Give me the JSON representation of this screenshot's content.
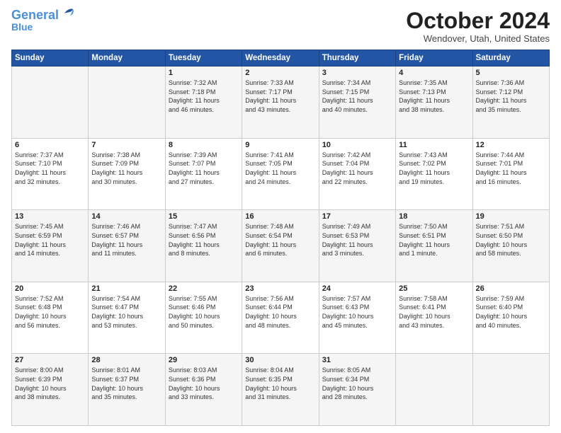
{
  "header": {
    "logo_general": "General",
    "logo_blue": "Blue",
    "month": "October 2024",
    "location": "Wendover, Utah, United States"
  },
  "days_of_week": [
    "Sunday",
    "Monday",
    "Tuesday",
    "Wednesday",
    "Thursday",
    "Friday",
    "Saturday"
  ],
  "weeks": [
    [
      {
        "day": "",
        "info": ""
      },
      {
        "day": "",
        "info": ""
      },
      {
        "day": "1",
        "info": "Sunrise: 7:32 AM\nSunset: 7:18 PM\nDaylight: 11 hours\nand 46 minutes."
      },
      {
        "day": "2",
        "info": "Sunrise: 7:33 AM\nSunset: 7:17 PM\nDaylight: 11 hours\nand 43 minutes."
      },
      {
        "day": "3",
        "info": "Sunrise: 7:34 AM\nSunset: 7:15 PM\nDaylight: 11 hours\nand 40 minutes."
      },
      {
        "day": "4",
        "info": "Sunrise: 7:35 AM\nSunset: 7:13 PM\nDaylight: 11 hours\nand 38 minutes."
      },
      {
        "day": "5",
        "info": "Sunrise: 7:36 AM\nSunset: 7:12 PM\nDaylight: 11 hours\nand 35 minutes."
      }
    ],
    [
      {
        "day": "6",
        "info": "Sunrise: 7:37 AM\nSunset: 7:10 PM\nDaylight: 11 hours\nand 32 minutes."
      },
      {
        "day": "7",
        "info": "Sunrise: 7:38 AM\nSunset: 7:09 PM\nDaylight: 11 hours\nand 30 minutes."
      },
      {
        "day": "8",
        "info": "Sunrise: 7:39 AM\nSunset: 7:07 PM\nDaylight: 11 hours\nand 27 minutes."
      },
      {
        "day": "9",
        "info": "Sunrise: 7:41 AM\nSunset: 7:05 PM\nDaylight: 11 hours\nand 24 minutes."
      },
      {
        "day": "10",
        "info": "Sunrise: 7:42 AM\nSunset: 7:04 PM\nDaylight: 11 hours\nand 22 minutes."
      },
      {
        "day": "11",
        "info": "Sunrise: 7:43 AM\nSunset: 7:02 PM\nDaylight: 11 hours\nand 19 minutes."
      },
      {
        "day": "12",
        "info": "Sunrise: 7:44 AM\nSunset: 7:01 PM\nDaylight: 11 hours\nand 16 minutes."
      }
    ],
    [
      {
        "day": "13",
        "info": "Sunrise: 7:45 AM\nSunset: 6:59 PM\nDaylight: 11 hours\nand 14 minutes."
      },
      {
        "day": "14",
        "info": "Sunrise: 7:46 AM\nSunset: 6:57 PM\nDaylight: 11 hours\nand 11 minutes."
      },
      {
        "day": "15",
        "info": "Sunrise: 7:47 AM\nSunset: 6:56 PM\nDaylight: 11 hours\nand 8 minutes."
      },
      {
        "day": "16",
        "info": "Sunrise: 7:48 AM\nSunset: 6:54 PM\nDaylight: 11 hours\nand 6 minutes."
      },
      {
        "day": "17",
        "info": "Sunrise: 7:49 AM\nSunset: 6:53 PM\nDaylight: 11 hours\nand 3 minutes."
      },
      {
        "day": "18",
        "info": "Sunrise: 7:50 AM\nSunset: 6:51 PM\nDaylight: 11 hours\nand 1 minute."
      },
      {
        "day": "19",
        "info": "Sunrise: 7:51 AM\nSunset: 6:50 PM\nDaylight: 10 hours\nand 58 minutes."
      }
    ],
    [
      {
        "day": "20",
        "info": "Sunrise: 7:52 AM\nSunset: 6:48 PM\nDaylight: 10 hours\nand 56 minutes."
      },
      {
        "day": "21",
        "info": "Sunrise: 7:54 AM\nSunset: 6:47 PM\nDaylight: 10 hours\nand 53 minutes."
      },
      {
        "day": "22",
        "info": "Sunrise: 7:55 AM\nSunset: 6:46 PM\nDaylight: 10 hours\nand 50 minutes."
      },
      {
        "day": "23",
        "info": "Sunrise: 7:56 AM\nSunset: 6:44 PM\nDaylight: 10 hours\nand 48 minutes."
      },
      {
        "day": "24",
        "info": "Sunrise: 7:57 AM\nSunset: 6:43 PM\nDaylight: 10 hours\nand 45 minutes."
      },
      {
        "day": "25",
        "info": "Sunrise: 7:58 AM\nSunset: 6:41 PM\nDaylight: 10 hours\nand 43 minutes."
      },
      {
        "day": "26",
        "info": "Sunrise: 7:59 AM\nSunset: 6:40 PM\nDaylight: 10 hours\nand 40 minutes."
      }
    ],
    [
      {
        "day": "27",
        "info": "Sunrise: 8:00 AM\nSunset: 6:39 PM\nDaylight: 10 hours\nand 38 minutes."
      },
      {
        "day": "28",
        "info": "Sunrise: 8:01 AM\nSunset: 6:37 PM\nDaylight: 10 hours\nand 35 minutes."
      },
      {
        "day": "29",
        "info": "Sunrise: 8:03 AM\nSunset: 6:36 PM\nDaylight: 10 hours\nand 33 minutes."
      },
      {
        "day": "30",
        "info": "Sunrise: 8:04 AM\nSunset: 6:35 PM\nDaylight: 10 hours\nand 31 minutes."
      },
      {
        "day": "31",
        "info": "Sunrise: 8:05 AM\nSunset: 6:34 PM\nDaylight: 10 hours\nand 28 minutes."
      },
      {
        "day": "",
        "info": ""
      },
      {
        "day": "",
        "info": ""
      }
    ]
  ]
}
